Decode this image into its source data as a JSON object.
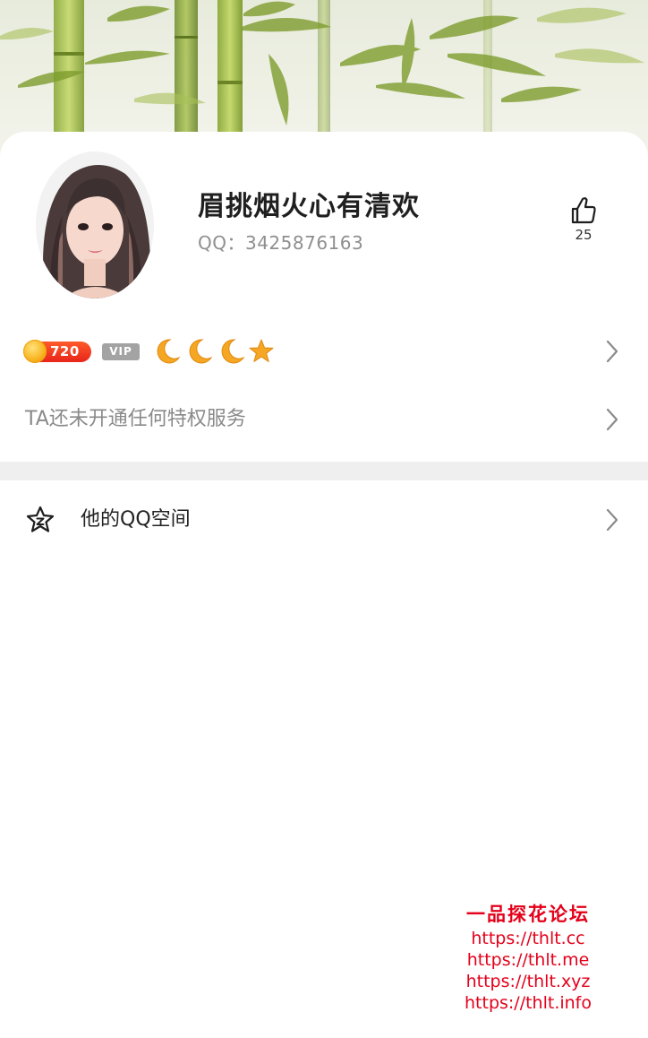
{
  "profile": {
    "nickname": "眉挑烟火心有清欢",
    "qq_line": "QQ：3425876163",
    "likes": "25"
  },
  "level": {
    "coin_value": "720",
    "vip_label": "VIP",
    "icons": [
      "moon-icon",
      "moon-icon",
      "moon-icon",
      "star-icon"
    ]
  },
  "privilege": {
    "text": "TA还未开通任何特权服务"
  },
  "qzone": {
    "label": "他的QQ空间"
  },
  "watermark": {
    "title": "一品探花论坛",
    "urls": [
      "https://thlt.cc",
      "https://thlt.me",
      "https://thlt.xyz",
      "https://thlt.info"
    ]
  },
  "colors": {
    "coin_badge": "#e8251a",
    "vip_badge": "#a3a3a3",
    "level_icon": "#f5a623",
    "watermark": "#e4001a"
  }
}
